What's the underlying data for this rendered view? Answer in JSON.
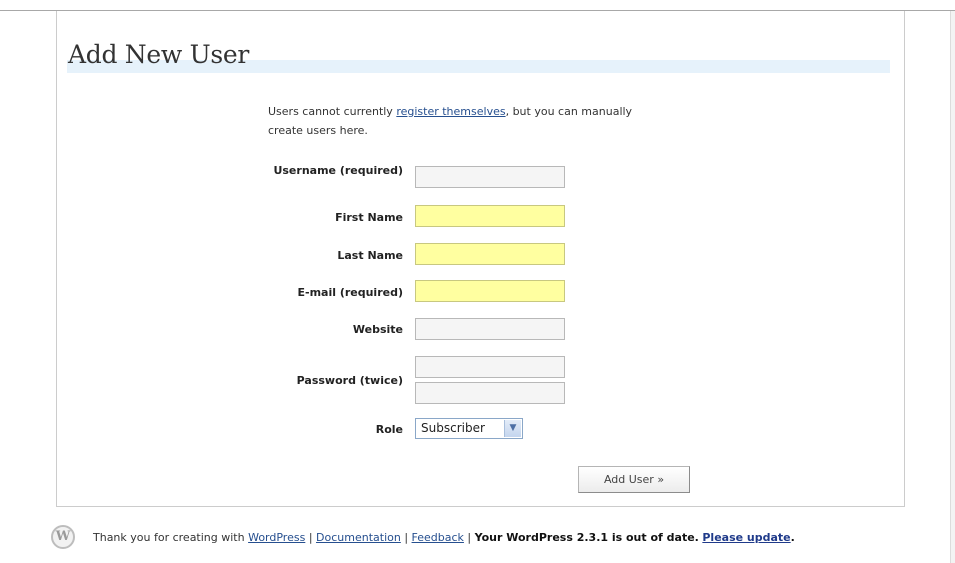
{
  "page": {
    "title": "Add New User",
    "intro_before": "Users cannot currently ",
    "intro_link": "register themselves",
    "intro_after": ", but you can manually create users here."
  },
  "form": {
    "username_label": "Username (required)",
    "first_name_label": "First Name",
    "last_name_label": "Last Name",
    "email_label": "E-mail (required)",
    "website_label": "Website",
    "password_label": "Password (twice)",
    "role_label": "Role",
    "role_value": "Subscriber",
    "submit_label": "Add User »",
    "username_value": "",
    "first_name_value": "",
    "last_name_value": "",
    "email_value": "",
    "website_value": "",
    "password1_value": "",
    "password2_value": ""
  },
  "footer": {
    "thanks": "Thank you for creating with ",
    "wordpress_link": "WordPress",
    "sep1": " | ",
    "documentation_link": "Documentation",
    "sep2": " | ",
    "feedback_link": "Feedback",
    "sep3": " | ",
    "outdated_text": "Your WordPress 2.3.1 is out of date.",
    "update_link": "Please update",
    "end": "."
  },
  "colors": {
    "highlight_field": "#ffffa0",
    "link": "#264f8f",
    "title_band": "#e6f2fb"
  },
  "icons": {
    "footer_logo": "wordpress-logo-icon",
    "select_arrow": "chevron-down-icon"
  }
}
